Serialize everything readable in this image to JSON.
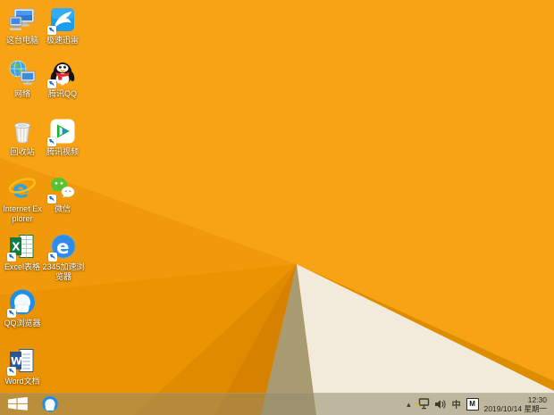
{
  "wallpaper": {
    "colors": {
      "bright_orange": "#F8A313",
      "mid_orange": "#F0990A",
      "deep_orange": "#EA9303",
      "darker_orange": "#E08A00",
      "darkest_orange": "#D68100",
      "ridge_orange": "#DC8E00",
      "tan_facet": "#A89B72",
      "cream": "#F2EBDB"
    }
  },
  "desktop": {
    "icons": [
      {
        "name": "this-pc",
        "label": "这台电脑"
      },
      {
        "name": "thunder-speed",
        "label": "极速迅雷"
      },
      {
        "name": "network",
        "label": "网络"
      },
      {
        "name": "tencent-qq",
        "label": "腾讯QQ"
      },
      {
        "name": "recycle-bin",
        "label": "回收站"
      },
      {
        "name": "tencent-video",
        "label": "腾讯视频"
      },
      {
        "name": "internet-explorer",
        "label": "Internet Explorer"
      },
      {
        "name": "wechat",
        "label": "微信"
      },
      {
        "name": "excel",
        "label": "Excel表格"
      },
      {
        "name": "browser-2345",
        "label": "2345加速浏览器"
      },
      {
        "name": "qq-browser",
        "label": "QQ浏览器"
      },
      {
        "name": "word",
        "label": "Word文档"
      }
    ]
  },
  "taskbar": {
    "tray": {
      "hidden_icons_glyph": "▴",
      "ime_mode": "中",
      "ime_badge": "M",
      "time": "12:30",
      "date": "2019/10/14 星期一"
    }
  }
}
